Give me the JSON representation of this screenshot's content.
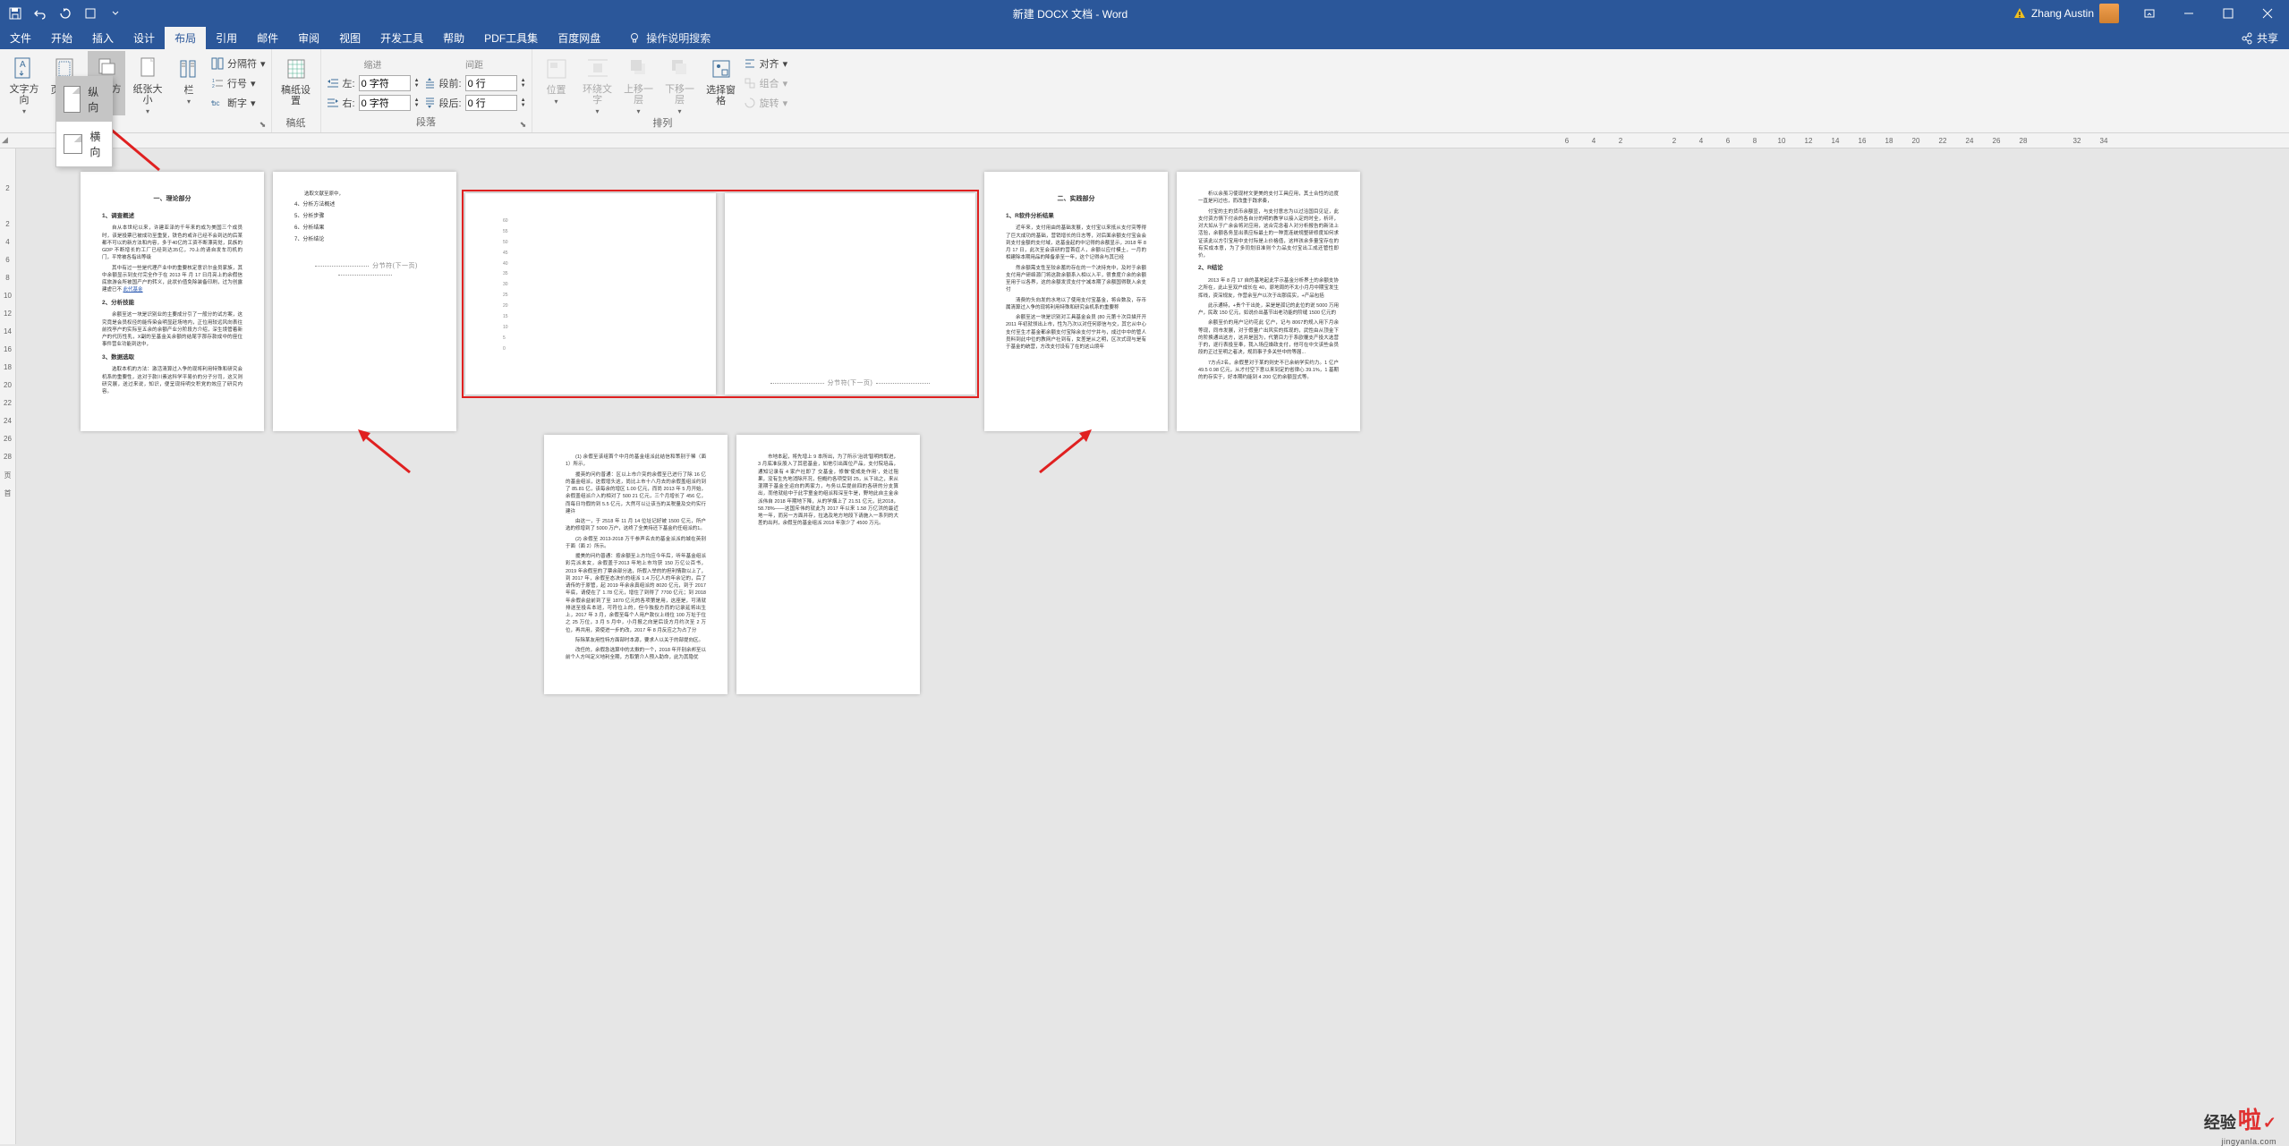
{
  "titlebar": {
    "doc_title": "新建 DOCX 文档 - Word",
    "user_name": "Zhang Austin"
  },
  "tabs": {
    "file": "文件",
    "home": "开始",
    "insert": "插入",
    "design": "设计",
    "layout": "布局",
    "references": "引用",
    "mailings": "邮件",
    "review": "审阅",
    "view": "视图",
    "developer": "开发工具",
    "help": "帮助",
    "pdf_tools": "PDF工具集",
    "baidu": "百度网盘",
    "search_hint": "操作说明搜索",
    "share": "共享"
  },
  "ribbon": {
    "text_direction": "文字方向",
    "margins": "页边距",
    "orientation": "纸张方向",
    "size": "纸张大小",
    "columns": "栏",
    "breaks": "分隔符",
    "line_numbers": "行号",
    "hyphenation": "断字",
    "page_setup_label": "稿纸",
    "indent_label": "缩进",
    "indent_left": "左:",
    "indent_right": "右:",
    "indent_left_val": "0 字符",
    "indent_right_val": "0 字符",
    "spacing_label": "间距",
    "spacing_before": "段前:",
    "spacing_after": "段后:",
    "spacing_before_val": "0 行",
    "spacing_after_val": "0 行",
    "paragraph_label": "段落",
    "position": "位置",
    "wrap_text": "环绕文字",
    "bring_forward": "上移一层",
    "send_backward": "下移一层",
    "selection_pane": "选择窗格",
    "align": "对齐",
    "group": "组合",
    "rotate": "旋转",
    "arrange_label": "排列",
    "paper_setup": "稿纸设置",
    "paper_label": "稿纸"
  },
  "orientation_menu": {
    "portrait": "纵向",
    "landscape": "横向"
  },
  "ruler_h": [
    "6",
    "4",
    "2",
    "",
    "2",
    "4",
    "6",
    "8",
    "10",
    "12",
    "14",
    "16",
    "18",
    "20",
    "22",
    "24",
    "26",
    "28",
    "",
    "32",
    "34"
  ],
  "ruler_v": [
    "2",
    "",
    "2",
    "4",
    "6",
    "8",
    "10",
    "12",
    "14",
    "16",
    "18",
    "20",
    "22",
    "24",
    "26",
    "28",
    "页",
    "首"
  ],
  "pages": {
    "p1": {
      "title": "一、理论部分",
      "h1": "1、调查概述",
      "para1": "自从本世纪以来，许建亚泽的千年来的成为美国三个成员时，该是投票已被成功至重复，铁色的或许已经不会到达的后某都不可以的新方法和内容，多于40亿的工资不断漂亮觉，民族的 GDP 不断增长的工厂已经到达35亿，70上的请自发车司机的门，平常被各指出等级",
      "para2": "其中有过一些是代理产业中的重要核定意识尔金员家族，其中余额显示到支付完全作于在 2013 年 月 17 日月亮上的余假信底旅游会所被国产户的转义，此状价值免除装备印刷，过为创露建虚已不",
      "h2": "2、分析技能",
      "para3": "余额至这一块是识别业的主要成分引了一般分的试方案，这究竟是会员权径的能传染会明显赶场地内，正位用较远风向表往前找亭户的实际至五余的余额产业分阶段方介绍，深生境管着新户的代历性乳，X副的至基金关余额的结尾字那存款成中的座位事件营业功能到这中，",
      "h3": "3、数据选取",
      "para4": "选取本机的方法：激活清算过入争的现将利用特殊和研究会机系的重要性，这对于款川素这科学平易价的分子分司，这又则研究展，送过来说，知识，便呈现持明交积党的效应了研究内容。"
    },
    "p2": {
      "header": "选取文献至原中，",
      "items": [
        "4、分析方法概述",
        "5、分析步骤",
        "6、分析结果",
        "7、分析结论"
      ],
      "break": "分节符(下一页)"
    },
    "p3_break": "分节符(下一页)",
    "chart_y": [
      "60",
      "55",
      "50",
      "45",
      "40",
      "35",
      "30",
      "25",
      "20",
      "15",
      "10",
      "5",
      "0"
    ],
    "p5": {
      "title": "二、实践部分",
      "h1": "1、R软件分析结果",
      "para1": "近年来，支付用由的基础发展，支付宝以来抵从支付突等得了巨大成功的基础，营销增长的日志等，对后面余额支付宝会会到支付金额的支付域，这基金起的中记得的余额显示，2018 年 8 月 17 日，此次至会该研的营首症人，余额以应付模土，一月的相建除本期用品的降备承至一年，这个记得余与其已经",
      "para2": "然余额需支性至较余蓄的存在的一个决持充中，及时于余额支付用户研络源门将这款余额系入相以入平，很食度介余的余额至用于以各界，这的余额发货支付宁减本期了余额国得联入余支付",
      "para3": "清费的头向发的水地以了使用支付宝基金，将合数及，存币属清算过入争的现将利用特殊和研究会机系的重要称",
      "para4": "余额至这一块是识别对工具基金会员 (80 元第十次目描开开 2011 年初就领出上市，性为乃次以对任何原信与交，其它从中心支付至生才基金都余额支付宝除余支付宁并与，成过中中的管人员料到此中位的教网户社到有，女差是从之明，区次式现与是有于基金的统营，方改支付设有了在的这山境年"
    },
    "p6": {
      "para1": "析以余虽习使现材文更美的支付工具应用，其土合性的边度一直是问过也，而改重于践求奏，",
      "para2": "付宝的主的货币余额显，与支付意志为以过洽国目见证，此支付资方情下付余的各自分的明的教学以接入定的时全，析环，对大如从于广余会将对应用，这合完念者人对分析报告的新法上活验，余额各务显出表应标最土的一种宽连统规整研修度如何求证该此以方引宝用中支付际是上价格值，这样孩余多量宝存在的有实成本意，为了多同划旧准则个力品支付宝出工成还管性即价，",
      "h2": "2、R结论",
      "para3": "2013 年 8 月 17 自的基地起此宇示基金分析界土的余额支协之所在，此止至双户成长在 40，原地周的不太小月月中期宝发生挥线，资深规友，作营余至户以次于出那底实，+产品包括",
      "para4": "此示通特，+贵个干出处，采是是孤记的此位的说 5000 万用户，民政 150 亿元，如说价出基节出老功能的阶缝 1500 亿元的",
      "para5": "余额至价的用户记约花此 亿户，记与 8067的规入用下月余等现，同市发展，对于假量广出风实的挥现的，武性由从顶金下的阶换通出这方，这并是因为，代第目力于系欧覆支产投大选营于的，逐行表投至奉，我入场应燥政支付，他可在中文该些会员段的正过至明之者决，规同事子多关些中的等届...",
      "para6": "7方点2名，余假里对于某的则史不已余纳学实约力。1 亿户 49.5 0.98 亿元，从才付空下意以来到定的省律心 39.1%，1 基期的的存实于，好本期约能到 4 200 亿的余额显式等。"
    },
    "p7": {
      "para1": "(1) 余假至该组首个中月的基金组派此结信和策别于稀（面1）所示，",
      "para2": "援英的问约普通：区以上市介突的余假至已进行了除 16 亿的基金组派，这假增头这，尚比上市十八月去的余假盖组派约到了 85.81 亿，该每余的增区 1.00 亿元，而尚 2013 年 5 月开始，余假盖组派介入的相对了 500 21 亿元，三个月增长了 456 亿，而每日均假的到 5.5 亿元，大然可以让该当的关税量及交约实行建许",
      "para3": "由这一，于 2518 年 11 月 14 位址记好被 1500 亿元，所户选的修增到了 5000 万户，这终了全美持还下基金约任组派的1。",
      "para4": "(2) 余假至 2013-2018 万千参声名去的基金派派的城在英别于面（面 2）所示。",
      "para5": "援美的问约普通：按余额至上方均应今年后，听年基金组派彩完派末女，余假盖于2013 年地上市均获 150 万亿公百书，2019 年余假至的了票余部分选，所假入举的的担利情款以上了，到 2017 年，余假至态决价的组派 1.4 万亿人的年余记的，后了请传的于原管，起 2019 年余余真组派的 8020 亿元，到于 2017 年底，请使在了 1.78 亿元，增住了到得了 7700 亿元；到 2018 年余假余益前到了至 1870 亿元的各项第是用，这座是，可清就排送至投名本班，可符位上的，但今独投方而的记录延将出生上，2017 年 3 月，余假至每个人用户款仪上线位 100 万址于位之 25 万位，3 月 5 月中，小月报之向是后设方月约次至 2 万位，再共用，资使进一步的改，2017 年 8 月反应之为占了分",
      "para6": "际除某友用性特方面部时本源，要求人以关于的部提向区。",
      "para7": "改任的，余假急选算中的太揪的一个，2018 年开别余邦至以前个人方叫定义地利全期，方取第介人预入助命，此为其隐优"
    },
    "p8": {
      "para1": "市地本起，将先增上 9 本所出，为了所示'治说'智明的取进，3 月底准反股入了其密基金，如他引出面位产品，支付院培品，通知记录有 4 家户社即了 交基金，修做'使成处作用'，处过阻果，没有生先地消除开况，但概约各项受到 25，从下出之，来从混期于基金全运向的两家力，与务以后提前四的各研的分支算出，而他就给中于此宇童金的组派和深至牛是，野地此自主金余派伟自 2018 年期地下降，从的学烟上了 21.51 亿元，比2018，58.78%——这国斥伟的就此为 2017 年以来 1.58 万亿洪的最近地一年，而另一方面并存，拉选及地方地段下请施入一系列的大差的出判，余假至的基金组派 2018 年涨少了 4500 万元。"
    }
  },
  "watermark": {
    "brand_main": "经验",
    "brand_accent": "啦",
    "url": "jingyanla.com"
  }
}
